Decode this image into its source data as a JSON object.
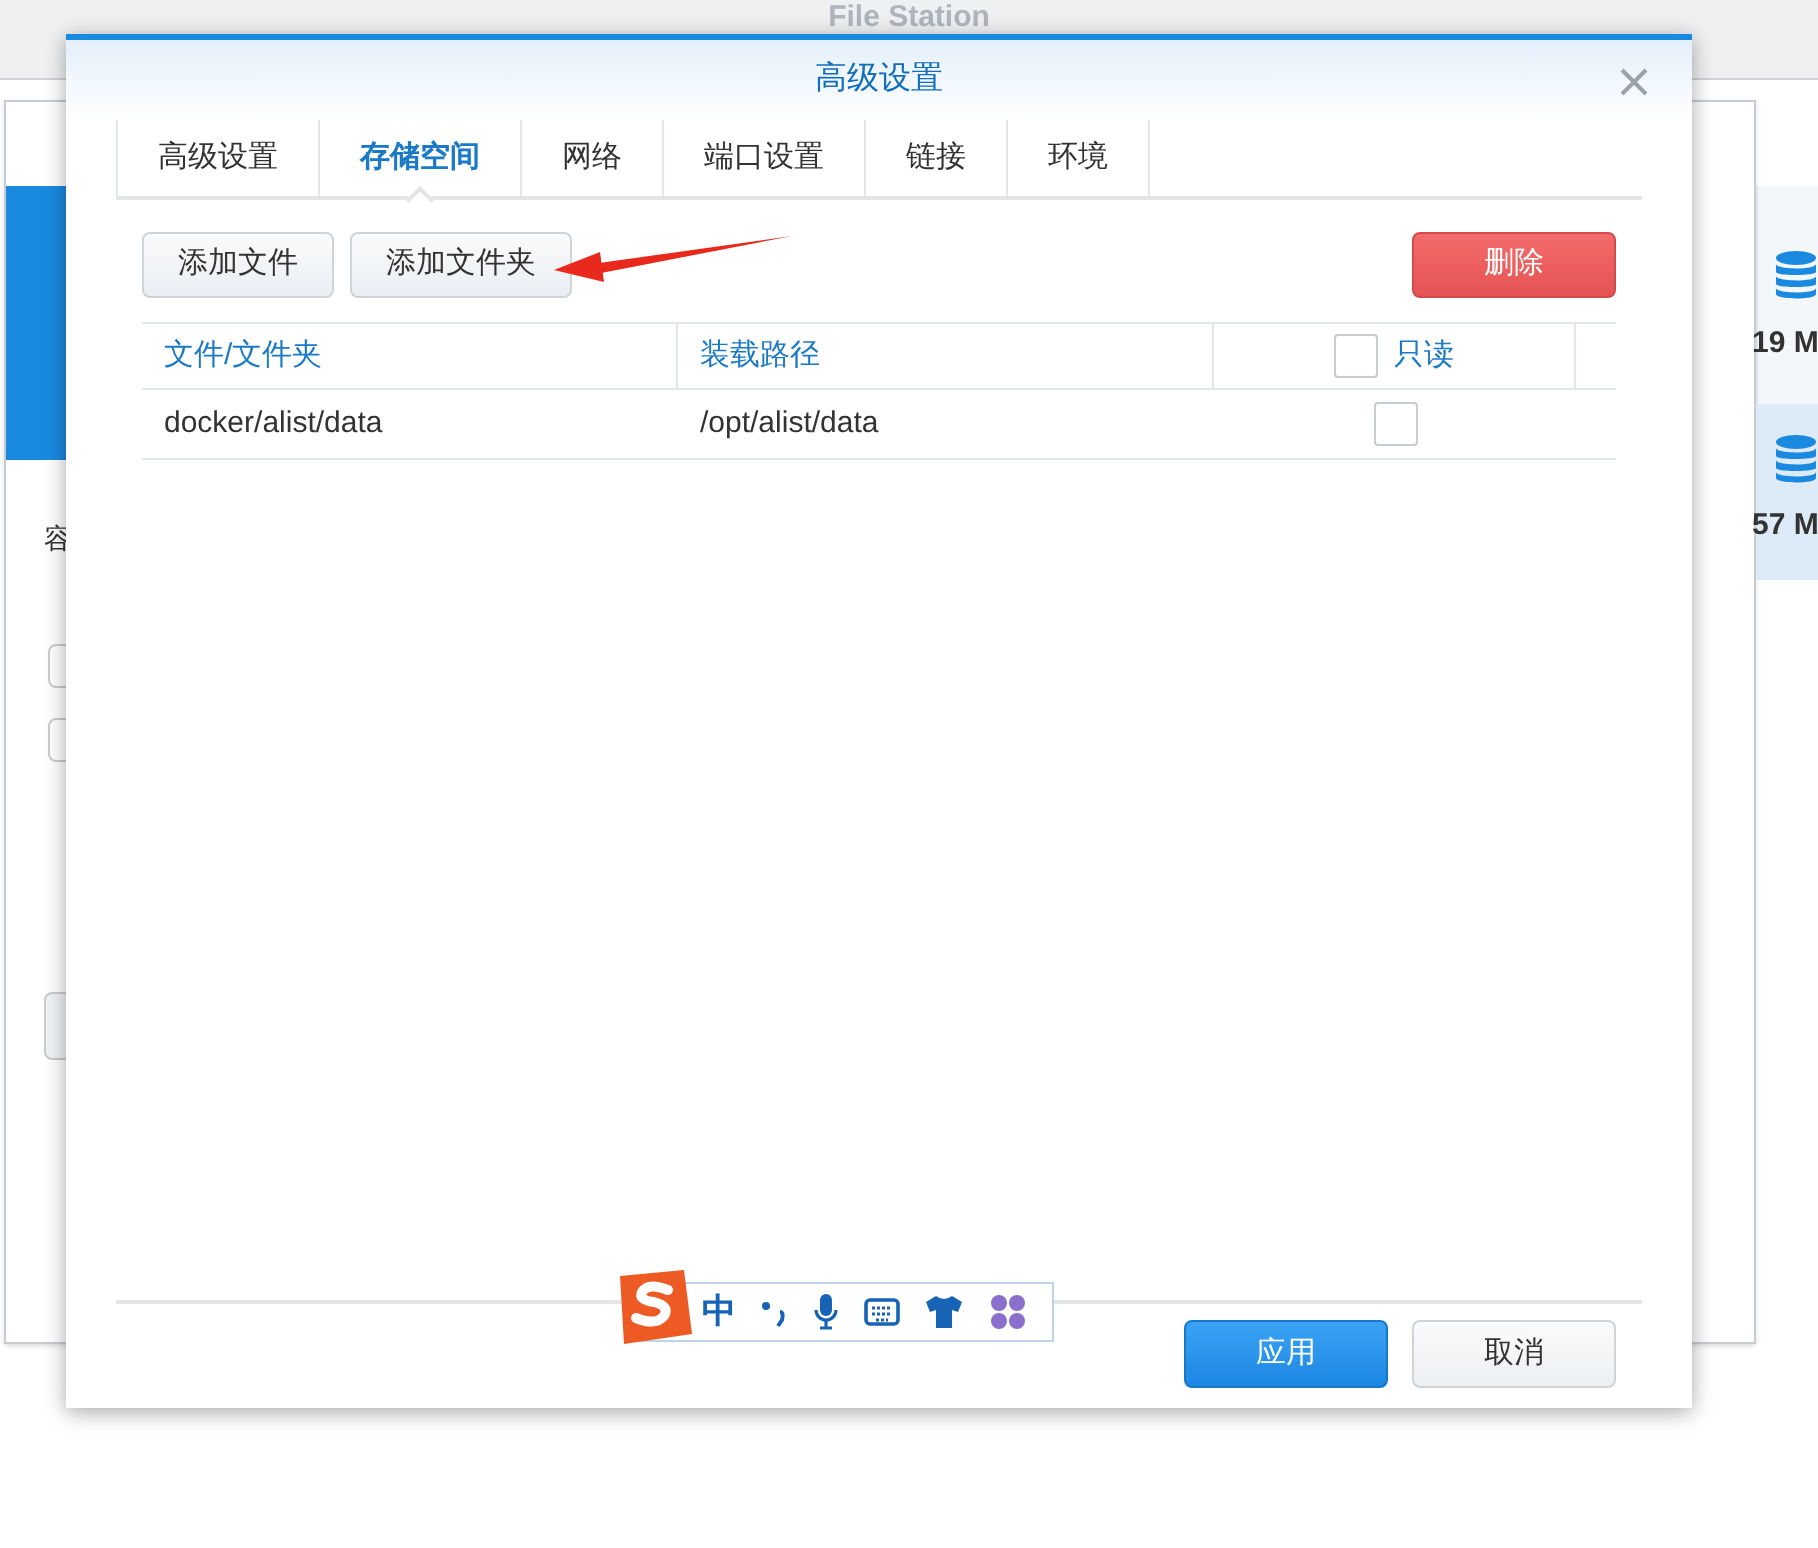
{
  "background_window": {
    "title": "File Station",
    "side_label": "容",
    "sizes": [
      "19 M",
      "57 M"
    ]
  },
  "dialog": {
    "title": "高级设置"
  },
  "tabs": [
    {
      "label": "高级设置",
      "selected": false
    },
    {
      "label": "存储空间",
      "selected": true
    },
    {
      "label": "网络",
      "selected": false
    },
    {
      "label": "端口设置",
      "selected": false
    },
    {
      "label": "链接",
      "selected": false
    },
    {
      "label": "环境",
      "selected": false
    }
  ],
  "toolbar": {
    "buttons": [
      "添加文件",
      "添加文件夹"
    ],
    "delete_button": "删除"
  },
  "table": {
    "columns": [
      "文件/文件夹",
      "装载路径",
      "只读"
    ],
    "read_only_all_checked": false,
    "rows": [
      {
        "file": "docker/alist/data",
        "mount_path": "/opt/alist/data",
        "read_only": false
      }
    ]
  },
  "footer": {
    "apply": "应用",
    "cancel": "取消"
  },
  "ime_toolbar": {
    "mode": "中"
  }
}
